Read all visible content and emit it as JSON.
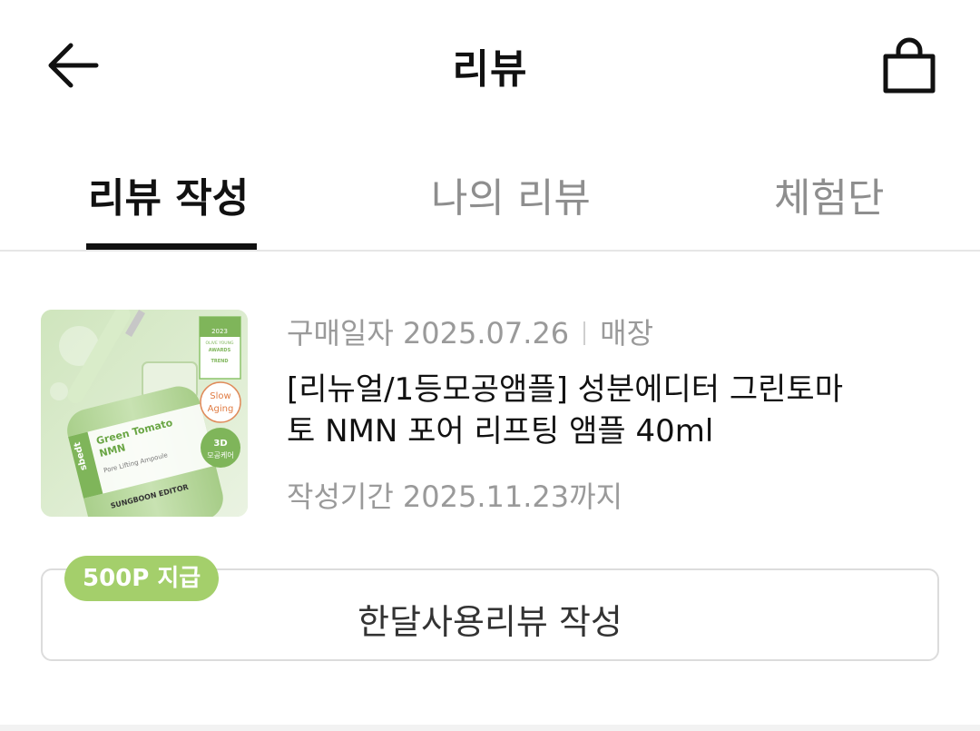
{
  "header": {
    "title": "리뷰"
  },
  "tabs": [
    {
      "label": "리뷰 작성",
      "active": true
    },
    {
      "label": "나의 리뷰",
      "active": false
    },
    {
      "label": "체험단",
      "active": false
    }
  ],
  "order": {
    "purchase_date_label": "구매일자",
    "purchase_date": "2025.07.26",
    "store": "매장",
    "product_name": "[리뉴얼/1등모공앰플] 성분에디터 그린토마토 NMN 포어 리프팅 앰플 40ml",
    "deadline": "작성기간 2025.11.23까지",
    "reward_badge": "500P 지급",
    "review_button": "한달사용리뷰 작성"
  },
  "product_image": {
    "bottle_label_brand": "sbedt",
    "bottle_label_line1": "Green Tomato",
    "bottle_label_line2": "NMN",
    "bottle_label_line3": "Pore Lifting Ampoule",
    "bottle_brand": "SUNGBOON EDITOR",
    "award_line1": "2023",
    "award_line2": "OLIVE YOUNG",
    "award_line3": "AWARDS",
    "award_line4": "TREND",
    "badge_slow": "Slow",
    "badge_aging": "Aging",
    "badge_3d": "3D",
    "badge_pore": "모공케어"
  },
  "colors": {
    "accent_green": "#a4cf6b",
    "text_primary": "#111111",
    "text_secondary": "#9a9a9a",
    "border": "#dcdcdc"
  },
  "icons": {
    "back": "arrow-left-icon",
    "cart": "shopping-bag-icon"
  }
}
